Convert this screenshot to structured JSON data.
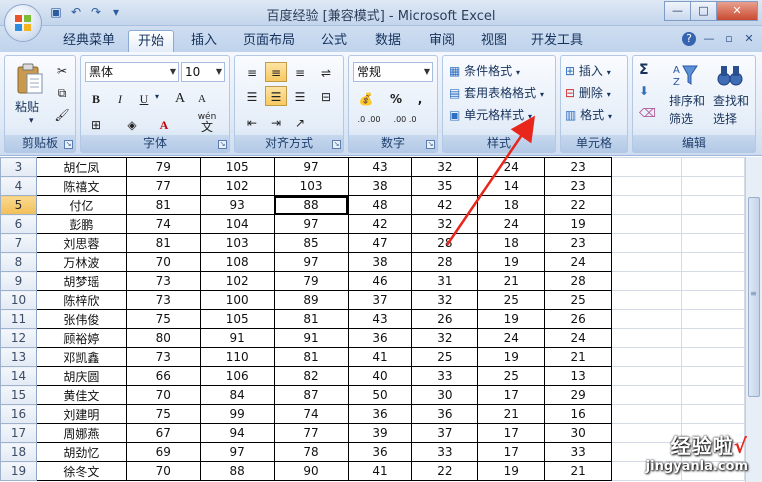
{
  "window": {
    "title": "百度经验  [兼容模式] - Microsoft Excel",
    "controls": [
      "—",
      "□",
      "✕"
    ]
  },
  "tabs": [
    "经典菜单",
    "开始",
    "插入",
    "页面布局",
    "公式",
    "数据",
    "审阅",
    "视图",
    "开发工具"
  ],
  "active_tab": "开始",
  "ribbon": {
    "clipboard": {
      "paste": "粘贴",
      "label": "剪贴板"
    },
    "font": {
      "name": "黑体",
      "size": "10",
      "bold": "B",
      "italic": "I",
      "underline": "U",
      "grow": "A",
      "shrink": "A",
      "wen": "wén",
      "wen2": "文",
      "label": "字体"
    },
    "alignment": {
      "label": "对齐方式"
    },
    "number": {
      "format": "常规",
      "percent": "%",
      "comma": ",",
      "dec_inc": ".0 .00",
      "dec_dec": ".00 .0",
      "label": "数字"
    },
    "styles": {
      "conditional": "条件格式",
      "table": "套用表格格式",
      "cell": "单元格样式",
      "label": "样式"
    },
    "cells": {
      "insert": "插入",
      "delete": "删除",
      "format": "格式",
      "label": "单元格"
    },
    "editing": {
      "sigma": "Σ",
      "sort": "排序和",
      "sort2": "筛选",
      "find": "查找和",
      "find2": "选择",
      "label": "编辑"
    }
  },
  "rows": [
    {
      "n": "3",
      "name": "胡仁凤",
      "v": [
        "79",
        "105",
        "97",
        "43",
        "32",
        "24",
        "23"
      ]
    },
    {
      "n": "4",
      "name": "陈禧文",
      "v": [
        "77",
        "102",
        "103",
        "38",
        "35",
        "14",
        "23"
      ]
    },
    {
      "n": "5",
      "name": "付亿",
      "v": [
        "81",
        "93",
        "88",
        "48",
        "42",
        "18",
        "22"
      ]
    },
    {
      "n": "6",
      "name": "彭鹏",
      "v": [
        "74",
        "104",
        "97",
        "42",
        "32",
        "24",
        "19"
      ]
    },
    {
      "n": "7",
      "name": "刘思蓉",
      "v": [
        "81",
        "103",
        "85",
        "47",
        "28",
        "18",
        "23"
      ]
    },
    {
      "n": "8",
      "name": "万林波",
      "v": [
        "70",
        "108",
        "97",
        "38",
        "28",
        "19",
        "24"
      ]
    },
    {
      "n": "9",
      "name": "胡梦瑶",
      "v": [
        "73",
        "102",
        "79",
        "46",
        "31",
        "21",
        "28"
      ]
    },
    {
      "n": "10",
      "name": "陈梓欣",
      "v": [
        "73",
        "100",
        "89",
        "37",
        "32",
        "25",
        "25"
      ]
    },
    {
      "n": "11",
      "name": "张伟俊",
      "v": [
        "75",
        "105",
        "81",
        "43",
        "26",
        "19",
        "26"
      ]
    },
    {
      "n": "12",
      "name": "顾裕婷",
      "v": [
        "80",
        "91",
        "91",
        "36",
        "32",
        "24",
        "24"
      ]
    },
    {
      "n": "13",
      "name": "邓凯鑫",
      "v": [
        "73",
        "110",
        "81",
        "41",
        "25",
        "19",
        "21"
      ]
    },
    {
      "n": "14",
      "name": "胡庆圆",
      "v": [
        "66",
        "106",
        "82",
        "40",
        "33",
        "25",
        "13"
      ]
    },
    {
      "n": "15",
      "name": "黄佳文",
      "v": [
        "70",
        "84",
        "87",
        "50",
        "30",
        "17",
        "29"
      ]
    },
    {
      "n": "16",
      "name": "刘建明",
      "v": [
        "75",
        "99",
        "74",
        "36",
        "36",
        "21",
        "16"
      ]
    },
    {
      "n": "17",
      "name": "周娜燕",
      "v": [
        "67",
        "94",
        "77",
        "39",
        "37",
        "17",
        "30"
      ]
    },
    {
      "n": "18",
      "name": "胡劲忆",
      "v": [
        "69",
        "97",
        "78",
        "36",
        "33",
        "17",
        "33"
      ]
    },
    {
      "n": "19",
      "name": "徐冬文",
      "v": [
        "70",
        "88",
        "90",
        "41",
        "22",
        "19",
        "21"
      ]
    }
  ],
  "selected_row": "5",
  "watermark": {
    "line1": "经验啦",
    "check": "√",
    "line2": "jingyanla.com"
  },
  "colors": {
    "accent_red": "#e8261c",
    "ribbon_blue": "#c3d5ec"
  }
}
